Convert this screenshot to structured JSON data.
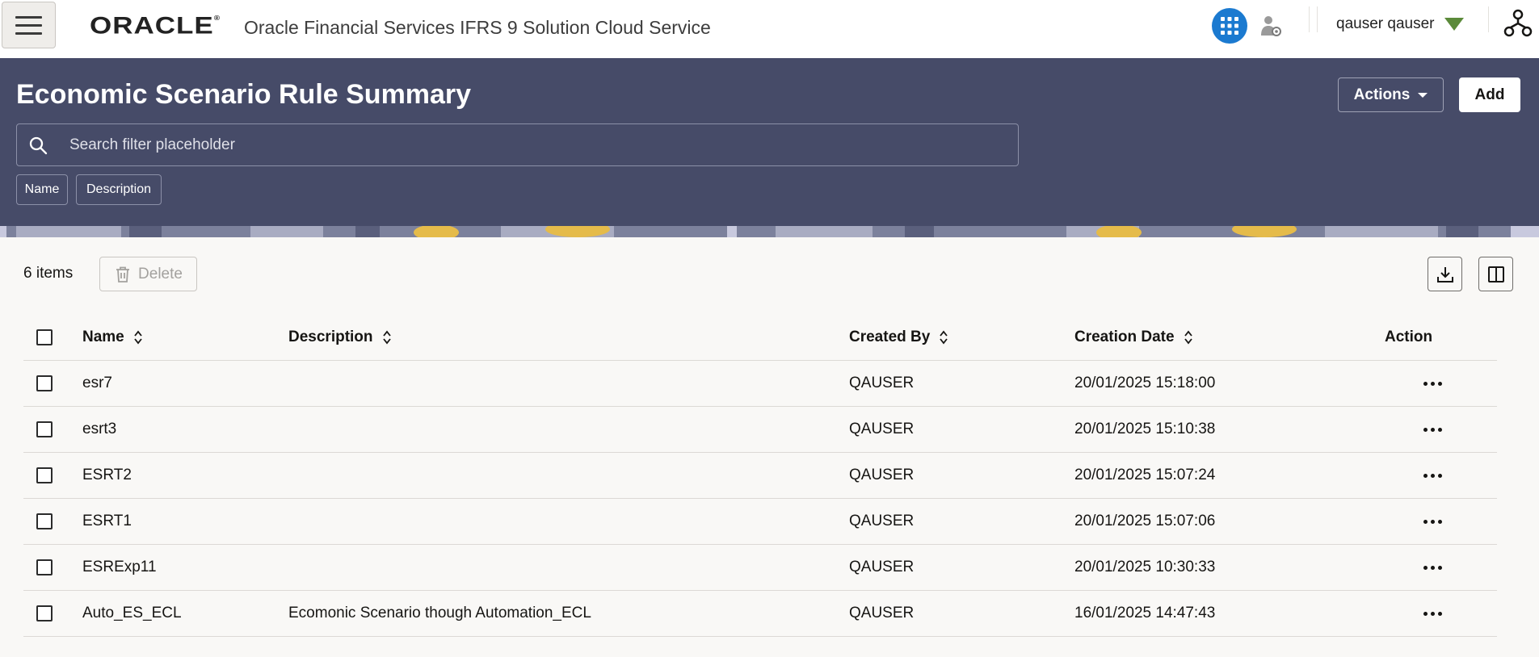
{
  "app": {
    "logo": "ORACLE",
    "title": "Oracle Financial Services IFRS 9 Solution Cloud Service",
    "user": "qauser qauser"
  },
  "header": {
    "page_title": "Economic Scenario Rule Summary",
    "actions_label": "Actions",
    "add_label": "Add",
    "search_placeholder": "Search filter placeholder",
    "filter_chips": [
      "Name",
      "Description"
    ]
  },
  "toolbar": {
    "items_count": "6 items",
    "delete_label": "Delete"
  },
  "table": {
    "columns": [
      "Name",
      "Description",
      "Created By",
      "Creation Date",
      "Action"
    ],
    "rows": [
      {
        "name": "esr7",
        "description": "",
        "created_by": "QAUSER",
        "creation_date": "20/01/2025 15:18:00"
      },
      {
        "name": "esrt3",
        "description": "",
        "created_by": "QAUSER",
        "creation_date": "20/01/2025 15:10:38"
      },
      {
        "name": "ESRT2",
        "description": "",
        "created_by": "QAUSER",
        "creation_date": "20/01/2025 15:07:24"
      },
      {
        "name": "ESRT1",
        "description": "",
        "created_by": "QAUSER",
        "creation_date": "20/01/2025 15:07:06"
      },
      {
        "name": "ESRExp11",
        "description": "",
        "created_by": "QAUSER",
        "creation_date": "20/01/2025 10:30:33"
      },
      {
        "name": "Auto_ES_ECL",
        "description": "Ecomonic Scenario though Automation_ECL",
        "created_by": "QAUSER",
        "creation_date": "16/01/2025 14:47:43"
      }
    ]
  },
  "icons": {
    "menu": "hamburger-menu-icon",
    "apps": "app-grid-icon",
    "admin": "admin-user-icon",
    "user_menu": "caret-down-icon",
    "org": "hierarchy-icon",
    "search": "search-icon",
    "delete": "trash-icon",
    "download": "download-icon",
    "columns": "column-panel-icon",
    "row_action": "more-horizontal-icon"
  },
  "colors": {
    "header_bg": "#464b68",
    "accent_blue": "#1b7ad0",
    "caret_green": "#5b8a3a",
    "page_bg": "#f9f8f6"
  }
}
